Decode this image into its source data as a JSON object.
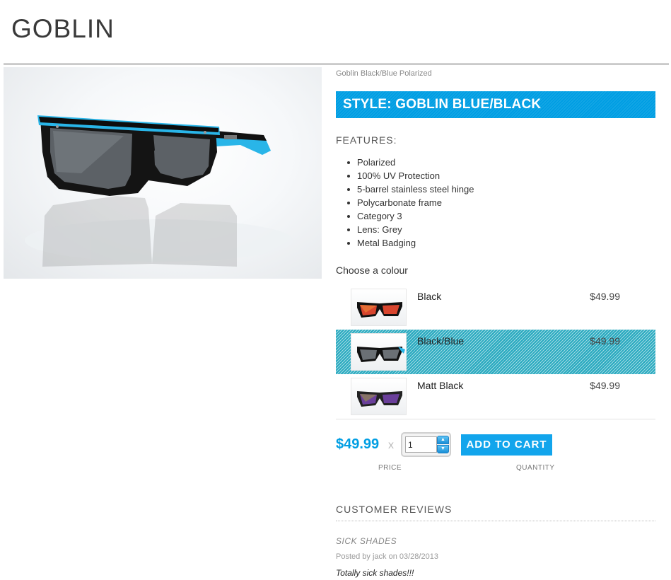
{
  "page": {
    "title": "GOBLIN"
  },
  "product": {
    "subtitle": "Goblin Black/Blue Polarized",
    "style_banner": "STYLE: GOBLIN BLUE/BLACK",
    "features_heading": "FEATURES:",
    "features": [
      "Polarized",
      "100% UV Protection",
      "5-barrel stainless steel hinge",
      "Polycarbonate frame",
      "Category 3",
      "Lens: Grey",
      "Metal Badging"
    ]
  },
  "colours": {
    "heading": "Choose a colour",
    "options": [
      {
        "name": "Black",
        "price": "$49.99",
        "lens_color": "#d8452e",
        "selected": false
      },
      {
        "name": "Black/Blue",
        "price": "$49.99",
        "lens_color": "#6b7075",
        "selected": true
      },
      {
        "name": "Matt Black",
        "price": "$49.99",
        "lens_color": "#6a3f9a",
        "selected": false
      }
    ]
  },
  "purchase": {
    "price": "$49.99",
    "times": "x",
    "quantity": "1",
    "add_to_cart": "ADD TO CART",
    "price_label": "PRICE",
    "quantity_label": "QUANTITY"
  },
  "reviews": {
    "heading": "CUSTOMER REVIEWS",
    "items": [
      {
        "title": "SICK SHADES",
        "meta": "Posted by jack on 03/28/2013",
        "body": "Totally sick shades!!!"
      }
    ]
  },
  "colors": {
    "accent": "#009ee3",
    "button": "#12a5ec"
  }
}
